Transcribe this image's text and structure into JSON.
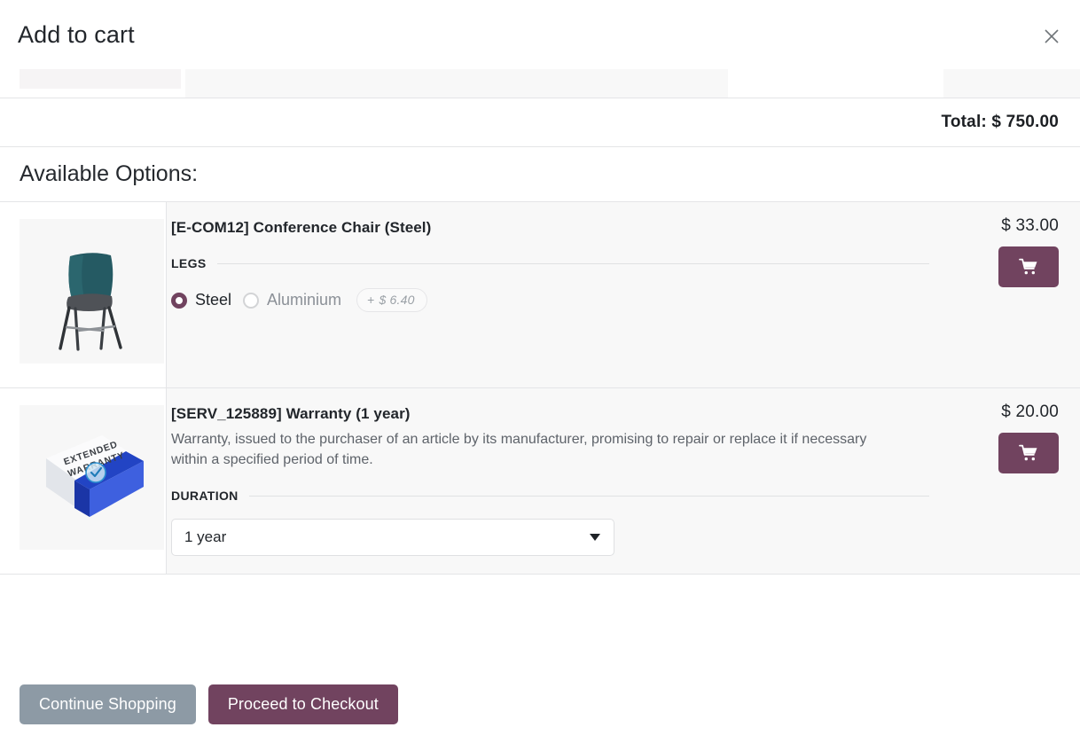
{
  "modal": {
    "title": "Add to cart",
    "close_icon": "close-icon"
  },
  "order_summary": {
    "total_label": "Total: $ 750.00"
  },
  "options_section": {
    "heading": "Available Options:"
  },
  "options": [
    {
      "name": "[E-COM12] Conference Chair (Steel)",
      "description": "",
      "price": "$ 33.00",
      "cart_icon": "shopping-cart-icon",
      "image_alt": "conference-chair-image",
      "attribute": {
        "label": "LEGS",
        "type": "radio",
        "choices": [
          {
            "label": "Steel",
            "selected": true,
            "extra_price": ""
          },
          {
            "label": "Aluminium",
            "selected": false,
            "extra_price": "$ 6.40",
            "extra_prefix": "+"
          }
        ]
      }
    },
    {
      "name": "[SERV_125889] Warranty (1 year)",
      "description": "Warranty, issued to the purchaser of an article by its manufacturer, promising to repair or replace it if necessary within a specified period of time.",
      "price": "$ 20.00",
      "cart_icon": "shopping-cart-icon",
      "image_alt": "extended-warranty-box-image",
      "attribute": {
        "label": "DURATION",
        "type": "select",
        "selected": "1 year"
      }
    }
  ],
  "footer": {
    "continue_shopping": "Continue Shopping",
    "proceed_to_checkout": "Proceed to Checkout"
  },
  "colors": {
    "primary": "#71435f",
    "secondary": "#8d9aa5",
    "surface": "#f8f8f8",
    "border": "#e4e5e7"
  }
}
